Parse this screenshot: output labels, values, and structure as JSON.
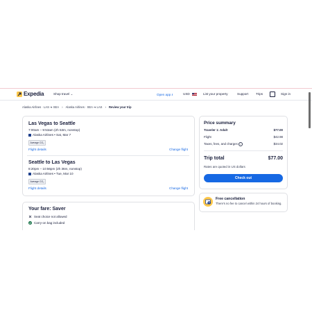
{
  "header": {
    "brand": "Expedia",
    "shop_travel": "Shop travel",
    "open_app": "Open app",
    "currency": "USD",
    "list_property": "List your property",
    "support": "Support",
    "trips": "Trips",
    "sign_in": "Sign in"
  },
  "breadcrumb": {
    "items": [
      "Alaska Airlines · LAS ➔ SEA",
      "Alaska Airlines · SEA ➔ LAS",
      "Review your trip"
    ]
  },
  "flights": [
    {
      "title": "Las Vegas to Seattle",
      "time": "7:00am – 9:53am (2h 53m, nonstop)",
      "airline": "Alaska Airlines • Sat, Mar 7",
      "badge": "Average CO₂",
      "details_link": "Flight details",
      "change_link": "Change flight"
    },
    {
      "title": "Seattle to Las Vegas",
      "time": "8:20pm – 10:56pm (2h 36m, nonstop)",
      "airline": "Alaska Airlines • Tue, Mar 10",
      "badge": "Average CO₂",
      "details_link": "Flight details",
      "change_link": "Change flight"
    }
  ],
  "fare": {
    "title": "Your fare: Saver",
    "rows": [
      "Seat choice not allowed",
      "Carry-on bag included"
    ]
  },
  "price_summary": {
    "title": "Price summary",
    "traveler_label": "Traveler 1: Adult",
    "traveler_value": "$77.00",
    "flight_label": "Flight",
    "flight_value": "$42.98",
    "taxes_label": "Taxes, fees, and charges",
    "taxes_value": "$34.02",
    "total_label": "Trip total",
    "total_value": "$77.00",
    "note": "Rates are quoted in US dollars",
    "button": "Check out"
  },
  "cancellation": {
    "title": "Free cancellation",
    "text": "There's no fee to cancel within 24 hours of booking."
  },
  "colors": {
    "accent": "#1668e3",
    "brand_yellow": "#ffc94c",
    "text": "#191e3b"
  }
}
